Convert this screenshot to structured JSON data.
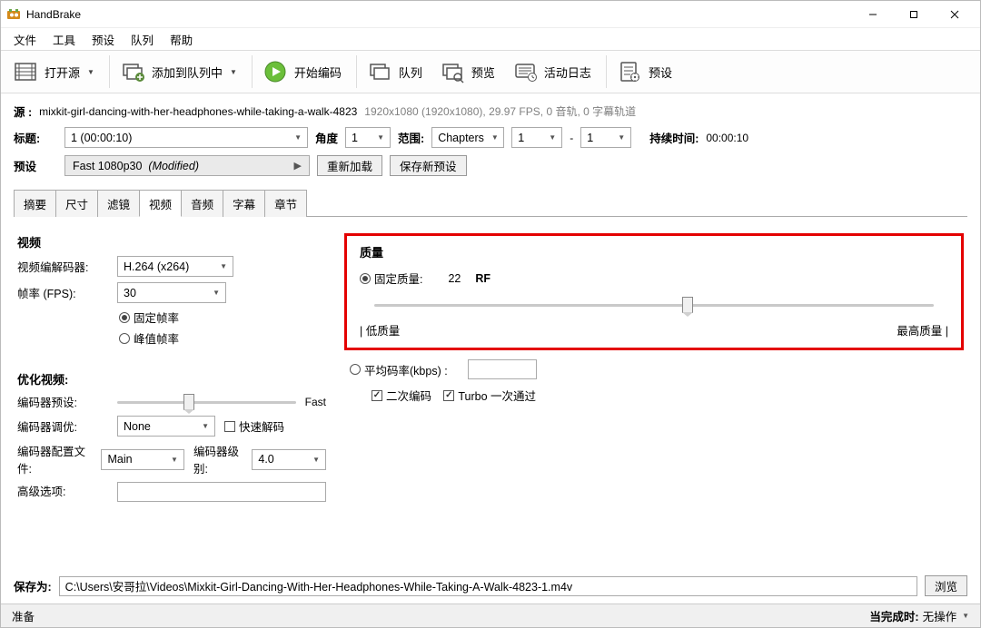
{
  "app": {
    "title": "HandBrake"
  },
  "menu": {
    "file": "文件",
    "tools": "工具",
    "presets": "预设",
    "queue": "队列",
    "help": "帮助"
  },
  "toolbar": {
    "open_source": "打开源",
    "add_to_queue": "添加到队列中",
    "start_encode": "开始编码",
    "queue": "队列",
    "preview": "预览",
    "activity": "活动日志",
    "presets": "预设"
  },
  "source": {
    "label": "源 :",
    "name": "mixkit-girl-dancing-with-her-headphones-while-taking-a-walk-4823",
    "info": "1920x1080 (1920x1080), 29.97 FPS, 0 音轨, 0 字幕轨道"
  },
  "title": {
    "label": "标题:",
    "value": "1 (00:00:10)",
    "angle_label": "角度",
    "angle": "1",
    "range_label": "范围:",
    "range_type": "Chapters",
    "range_start": "1",
    "range_dash": "-",
    "range_end": "1",
    "duration_label": "持续时间:",
    "duration": "00:00:10"
  },
  "preset": {
    "label": "预设",
    "name": "Fast 1080p30",
    "modified": "(Modified)",
    "reload": "重新加载",
    "save_new": "保存新预设"
  },
  "tabs": {
    "summary": "摘要",
    "dimensions": "尺寸",
    "filters": "滤镜",
    "video": "视频",
    "audio": "音频",
    "subtitles": "字幕",
    "chapters": "章节"
  },
  "video": {
    "section": "视频",
    "codec_label": "视频编解码器:",
    "codec": "H.264 (x264)",
    "fps_label": "帧率 (FPS):",
    "fps": "30",
    "fps_constant": "固定帧率",
    "fps_peak": "峰值帧率",
    "optimise_title": "优化视频:",
    "encoder_preset_label": "编码器预设:",
    "encoder_preset_value": "Fast",
    "encoder_tune_label": "编码器调优:",
    "encoder_tune": "None",
    "fast_decode": "快速解码",
    "profile_label": "编码器配置文件:",
    "profile": "Main",
    "level_label": "编码器级别:",
    "level": "4.0",
    "advanced_label": "高级选项:"
  },
  "quality": {
    "title": "质量",
    "constant_label": "固定质量:",
    "rf_value": "22",
    "rf_unit": "RF",
    "low_label": "| 低质量",
    "high_label": "最高质量 |",
    "avg_bitrate_label": "平均码率(kbps) :",
    "two_pass": "二次编码",
    "turbo": "Turbo 一次通过"
  },
  "save": {
    "label": "保存为:",
    "path": "C:\\Users\\安哥拉\\Videos\\Mixkit-Girl-Dancing-With-Her-Headphones-While-Taking-A-Walk-4823-1.m4v",
    "browse": "浏览"
  },
  "status": {
    "ready": "准备",
    "when_done_label": "当完成时:",
    "when_done": "无操作"
  }
}
